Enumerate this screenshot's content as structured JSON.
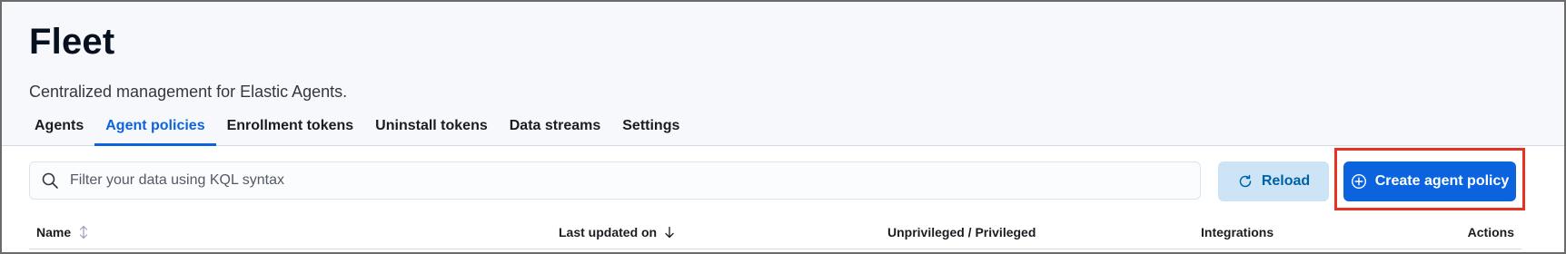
{
  "header": {
    "title": "Fleet",
    "subtitle": "Centralized management for Elastic Agents."
  },
  "tabs": [
    {
      "label": "Agents",
      "active": false
    },
    {
      "label": "Agent policies",
      "active": true
    },
    {
      "label": "Enrollment tokens",
      "active": false
    },
    {
      "label": "Uninstall tokens",
      "active": false
    },
    {
      "label": "Data streams",
      "active": false
    },
    {
      "label": "Settings",
      "active": false
    }
  ],
  "search": {
    "placeholder": "Filter your data using KQL syntax",
    "value": "",
    "icon": "search-icon"
  },
  "toolbar": {
    "reload_label": "Reload",
    "reload_icon": "refresh-icon",
    "create_label": "Create agent policy",
    "create_icon": "plus-circle-icon"
  },
  "table": {
    "columns": [
      {
        "label": "Name",
        "sort": "sortable"
      },
      {
        "label": "Last updated on",
        "sort": "descending"
      },
      {
        "label": "Unprivileged / Privileged",
        "sort": null
      },
      {
        "label": "Integrations",
        "sort": null
      },
      {
        "label": "Actions",
        "sort": null
      }
    ]
  },
  "colors": {
    "accent": "#0b64dd",
    "reload_bg": "#cce4f5",
    "highlight": "#e8321f",
    "header_bg": "#f7f8fc"
  }
}
